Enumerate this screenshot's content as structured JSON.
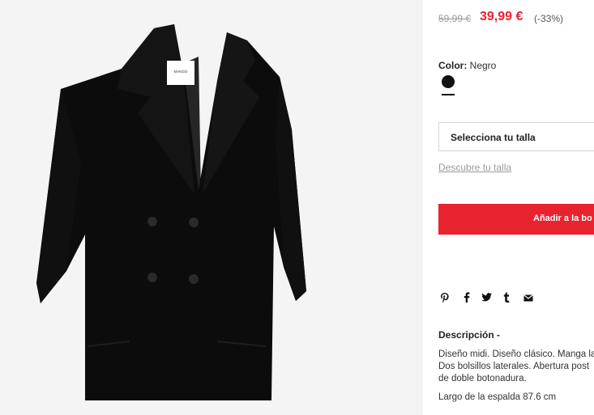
{
  "product": {
    "image_alt": "Black double-breasted coat",
    "label_brand": "MANGO",
    "price": {
      "original": "59,99 €",
      "sale": "39,99 €",
      "discount": "(-33%)"
    },
    "color": {
      "label": "Color:",
      "value": "Negro",
      "swatch_hex": "#111111"
    },
    "size": {
      "select_label": "Selecciona tu talla",
      "guide_link": "Descubre tu talla"
    },
    "add_to_bag_label": "Añadir a la bo",
    "share_icons": [
      "pinterest-icon",
      "facebook-icon",
      "twitter-icon",
      "tumblr-icon",
      "email-icon"
    ],
    "share_glyphs": [
      "℗",
      "f",
      "🐦",
      "t",
      "✉"
    ],
    "description": {
      "title": "Descripción -",
      "lines": [
        "Diseño midi. Diseño clásico. Manga la",
        "Dos bolsillos laterales. Abertura post",
        "de doble botonadura."
      ],
      "measure": "Largo de la espalda 87.6 cm"
    }
  },
  "colors": {
    "accent": "#e8232f",
    "image_bg": "#f4f4f4"
  }
}
